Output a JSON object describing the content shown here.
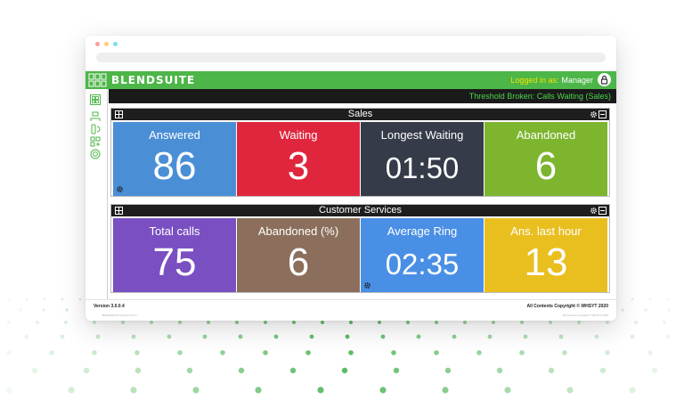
{
  "app": {
    "logo_text": "BLENDSUITE",
    "login_prefix": "Logged in as:",
    "login_user": "Manager"
  },
  "threshold_message": "Threshold Broken: Calls Waiting (Sales)",
  "sidebar": {
    "items": [
      {
        "icon": "dashboard-grid-icon",
        "active": true
      },
      {
        "icon": "agents-icon"
      },
      {
        "icon": "phone-icon"
      },
      {
        "icon": "layout-icon"
      },
      {
        "icon": "target-icon"
      }
    ]
  },
  "panels": [
    {
      "title": "Sales",
      "tiles": [
        {
          "label": "Answered",
          "value": "86",
          "color": "#4a8fd6"
        },
        {
          "label": "Waiting",
          "value": "3",
          "color": "#e0263d"
        },
        {
          "label": "Longest Waiting",
          "value": "01:50",
          "color": "#353b48"
        },
        {
          "label": "Abandoned",
          "value": "6",
          "color": "#7db52f"
        }
      ]
    },
    {
      "title": "Customer Services",
      "tiles": [
        {
          "label": "Total calls",
          "value": "75",
          "color": "#7a4fc2"
        },
        {
          "label": "Abandoned (%)",
          "value": "6",
          "color": "#8b6f5c"
        },
        {
          "label": "Average Ring",
          "value": "02:35",
          "color": "#4a8fe6"
        },
        {
          "label": "Ans. last hour",
          "value": "13",
          "color": "#e9be1f"
        }
      ]
    }
  ],
  "footer": {
    "version": "Version 3.0.0.4",
    "copyright": "All Contents Copyright © WHSYT 2020",
    "version_faint": "BLENDSUITE Version 3.0.0.x",
    "copyright_faint": "All Contents copyright © WHSYT 2020"
  },
  "colors": {
    "brand_green": "#4cb648",
    "threshold_text": "#4cd64c",
    "login_prefix": "#f5e200"
  }
}
